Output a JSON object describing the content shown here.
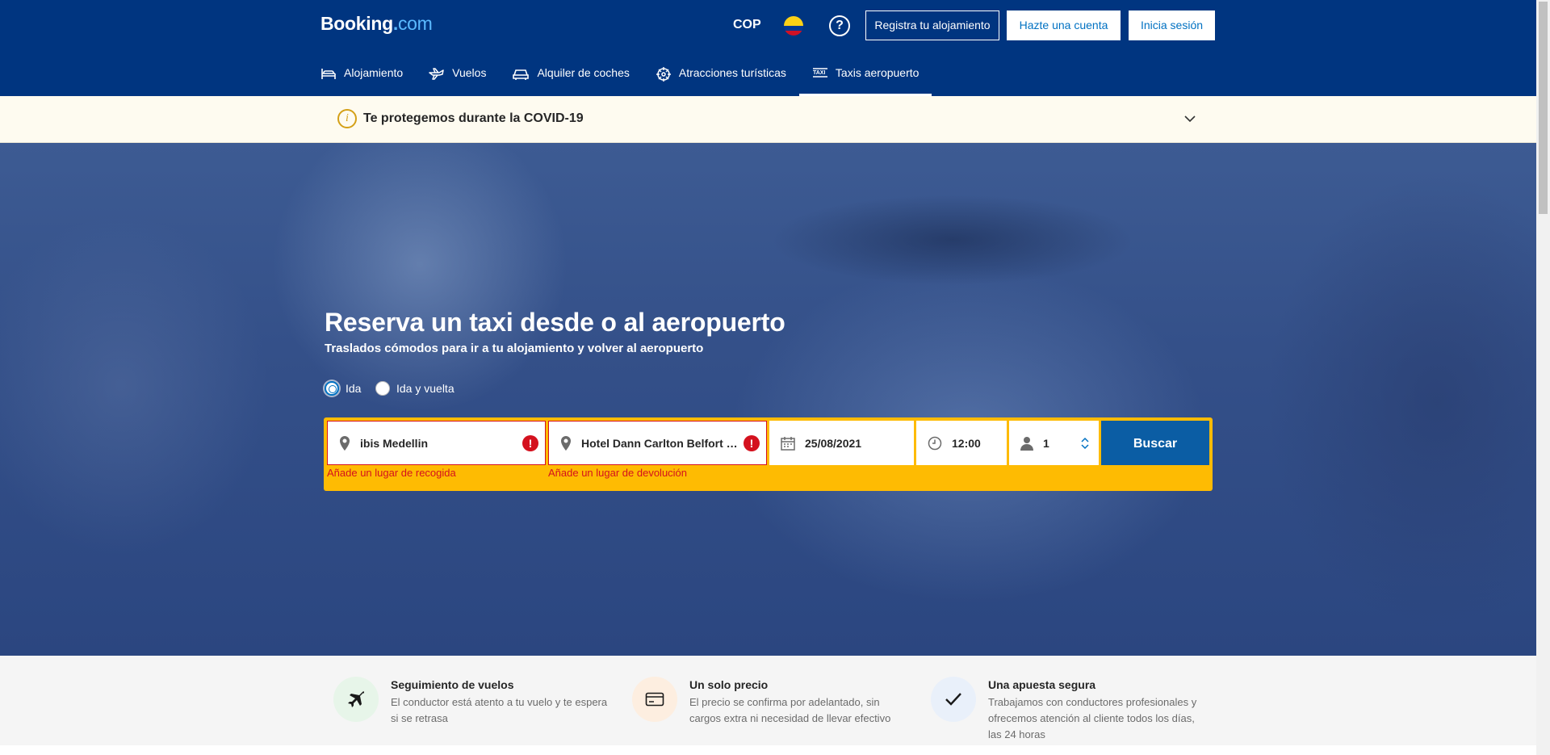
{
  "header": {
    "logo_main": "Booking",
    "logo_dot": ".",
    "logo_com": "com",
    "currency": "COP",
    "help_glyph": "?",
    "register_label": "Registra tu alojamiento",
    "create_account_label": "Hazte una cuenta",
    "login_label": "Inicia sesión"
  },
  "nav": {
    "items": [
      {
        "label": "Alojamiento",
        "icon": "bed-icon"
      },
      {
        "label": "Vuelos",
        "icon": "plane-icon"
      },
      {
        "label": "Alquiler de coches",
        "icon": "car-icon"
      },
      {
        "label": "Atracciones turísticas",
        "icon": "attractions-icon"
      },
      {
        "label": "Taxis aeropuerto",
        "icon": "taxi-icon",
        "active": true
      }
    ]
  },
  "covid": {
    "icon_glyph": "i",
    "text": "Te protegemos durante la COVID-19"
  },
  "hero": {
    "title": "Reserva un taxi desde o al aeropuerto",
    "subtitle": "Traslados cómodos para ir a tu alojamiento y volver al aeropuerto",
    "trip_options": [
      {
        "label": "Ida",
        "selected": true
      },
      {
        "label": "Ida y vuelta",
        "selected": false
      }
    ]
  },
  "search": {
    "pickup_value": "ibis Medellin",
    "pickup_error": "Añade un lugar de recogida",
    "dropoff_value": "Hotel Dann Carlton Belfort Medellin",
    "dropoff_error": "Añade un lugar de devolución",
    "error_glyph": "!",
    "date_value": "25/08/2021",
    "time_value": "12:00",
    "passengers_value": "1",
    "search_label": "Buscar"
  },
  "features": [
    {
      "title": "Seguimiento de vuelos",
      "description": "El conductor está atento a tu vuelo y te espera si se retrasa",
      "icon": "plane-icon"
    },
    {
      "title": "Un solo precio",
      "description": "El precio se confirma por adelantado, sin cargos extra ni necesidad de llevar efectivo",
      "icon": "card-icon"
    },
    {
      "title": "Una apuesta segura",
      "description": "Trabajamos con conductores profesionales y ofrecemos atención al cliente todos los días, las 24 horas",
      "icon": "check-icon"
    }
  ],
  "colors": {
    "brand_blue": "#003580",
    "accent_yellow": "#febb02",
    "search_button": "#0b5da4",
    "error_red": "#d4111e"
  }
}
